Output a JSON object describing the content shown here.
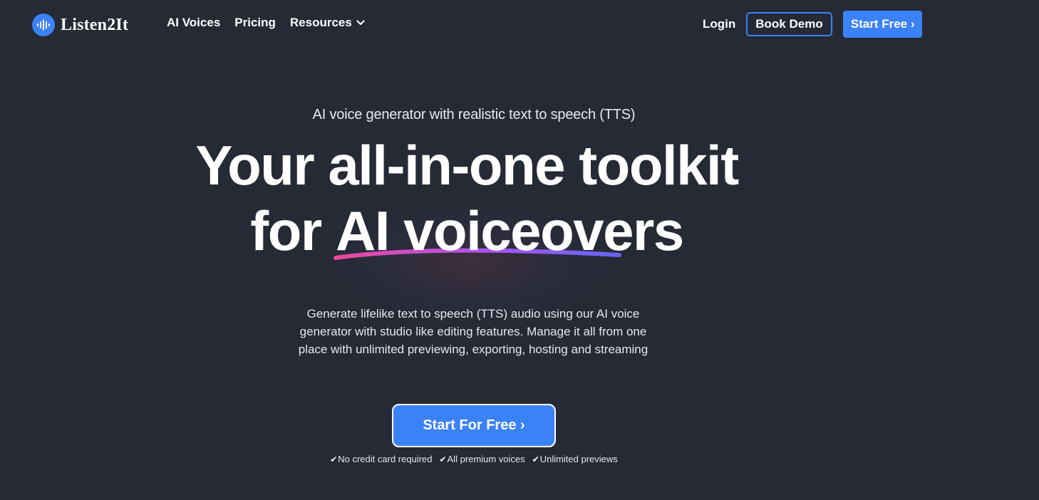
{
  "brand": {
    "name": "Listen2It",
    "accent_color": "#3b82f6",
    "background_color": "#252a35"
  },
  "nav": {
    "links": [
      {
        "label": "AI Voices"
      },
      {
        "label": "Pricing"
      },
      {
        "label": "Resources",
        "icon": "chevron-down-icon"
      }
    ],
    "login_label": "Login",
    "book_demo_label": "Book Demo",
    "start_free_label": "Start Free ›"
  },
  "hero": {
    "eyebrow": "AI voice generator with realistic text to speech (TTS)",
    "headline_line1": "Your all-in-one toolkit",
    "headline_line2_prefix": "for ",
    "headline_line2_accent": "AI voiceovers",
    "underline_gradient": [
      "#ec4899",
      "#a855f7",
      "#6366f1"
    ],
    "description": "Generate lifelike text to speech (TTS) audio using our AI voice generator with studio like editing features.  Manage it all from one place with unlimited previewing, exporting, hosting and streaming",
    "cta_label": "Start For Free ›",
    "perks": [
      {
        "icon": "check-icon",
        "label": "No credit card required"
      },
      {
        "icon": "check-icon",
        "label": "All premium voices"
      },
      {
        "icon": "check-icon",
        "label": "Unlimited previews"
      }
    ]
  }
}
